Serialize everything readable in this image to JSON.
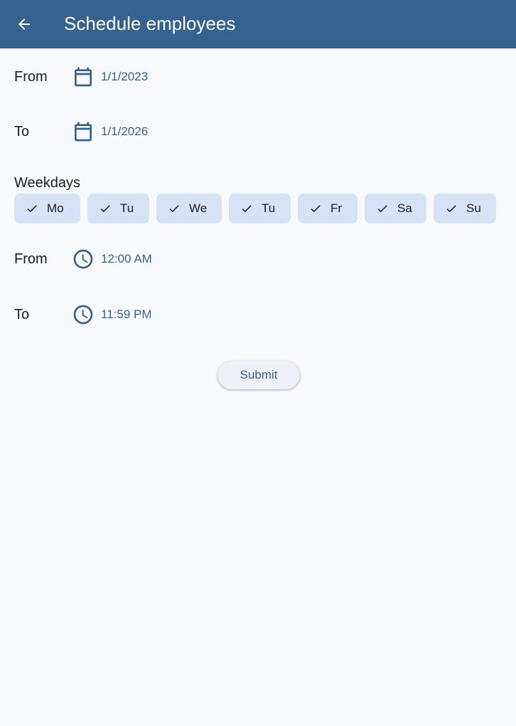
{
  "appbar": {
    "title": "Schedule employees",
    "back_icon": "arrow-left-icon",
    "background": "#35628f"
  },
  "date_range": {
    "from_label": "From",
    "from_value": "1/1/2023",
    "to_label": "To",
    "to_value": "1/1/2026",
    "icon": "calendar-icon"
  },
  "weekdays": {
    "label": "Weekdays",
    "chips": [
      {
        "label": "Mo",
        "selected": true
      },
      {
        "label": "Tu",
        "selected": true
      },
      {
        "label": "We",
        "selected": true
      },
      {
        "label": "Tu",
        "selected": true
      },
      {
        "label": "Fr",
        "selected": true
      },
      {
        "label": "Sa",
        "selected": true
      },
      {
        "label": "Su",
        "selected": true
      }
    ],
    "chip_color": "#d6e3f7"
  },
  "time_range": {
    "from_label": "From",
    "from_value": "12:00 AM",
    "to_label": "To",
    "to_value": "11:59 PM",
    "icon": "clock-icon"
  },
  "submit": {
    "label": "Submit"
  },
  "colors": {
    "accent": "#35628f",
    "background": "#f8f9fd"
  }
}
